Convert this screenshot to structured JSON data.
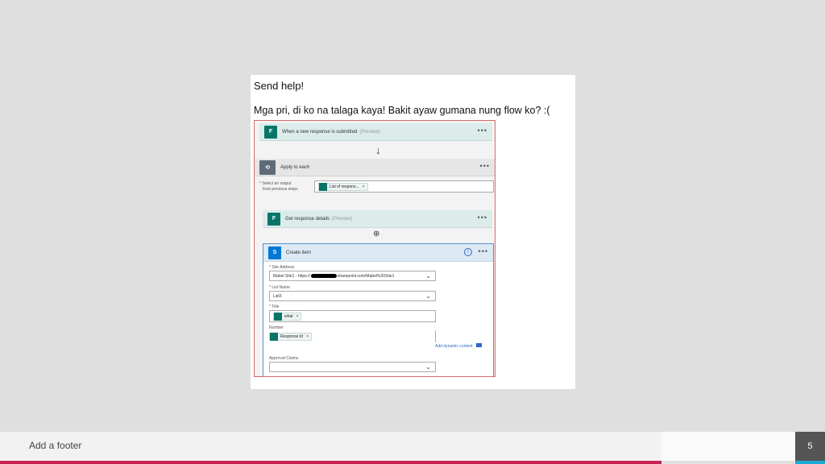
{
  "post": {
    "title": "Send help!",
    "body": "Mga pri, di ko na talaga kaya! Bakit ayaw gumana nung flow ko? :("
  },
  "flow": {
    "trigger": {
      "label": "When a new response is submitted",
      "tag": "(Preview)",
      "icon": "forms-icon"
    },
    "loop": {
      "label": "Apply to each",
      "field_label_1": "* Select an output",
      "field_label_2": "from previous steps",
      "token": "List of respons...",
      "icon": "loop-icon"
    },
    "get_details": {
      "label": "Get response details",
      "tag": "(Preview)",
      "icon": "forms-icon"
    },
    "create_item": {
      "label": "Create item",
      "icon": "sharepoint-icon",
      "site_label": "* Site Address",
      "site_value_prefix": "Mabel Site1 - https://",
      "site_value_suffix": "sharepoint.com/Mabel%20Site1",
      "list_label": "* List Name",
      "list_value": "List3",
      "title_label": "* Title",
      "title_token": "what",
      "number_label": "Number",
      "number_token": "Response Id",
      "add_dynamic": "Add dynamic content",
      "approval_label": "Approval Claims"
    }
  },
  "footer": {
    "text": "Add a footer",
    "page": "5"
  },
  "colors": {
    "accent_red": "#c4234f",
    "accent_blue": "#1da9d6",
    "forms_green": "#077568",
    "sharepoint_blue": "#0078d4"
  }
}
